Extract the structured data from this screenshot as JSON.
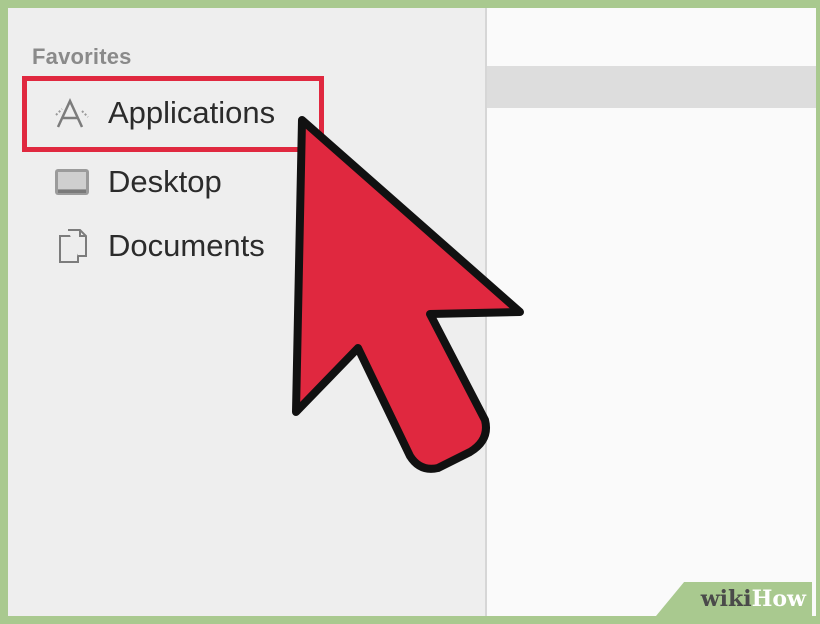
{
  "sidebar": {
    "section_title": "Favorites",
    "items": [
      {
        "label": "Applications",
        "icon": "applications-icon",
        "highlighted": true
      },
      {
        "label": "Desktop",
        "icon": "desktop-folder-icon"
      },
      {
        "label": "Documents",
        "icon": "documents-icon"
      }
    ]
  },
  "colors": {
    "highlight": "#e0283f",
    "cursor_fill": "#e0283f",
    "frame_border": "#a9c98f"
  },
  "watermark": {
    "prefix": "wiki",
    "suffix": "How"
  }
}
